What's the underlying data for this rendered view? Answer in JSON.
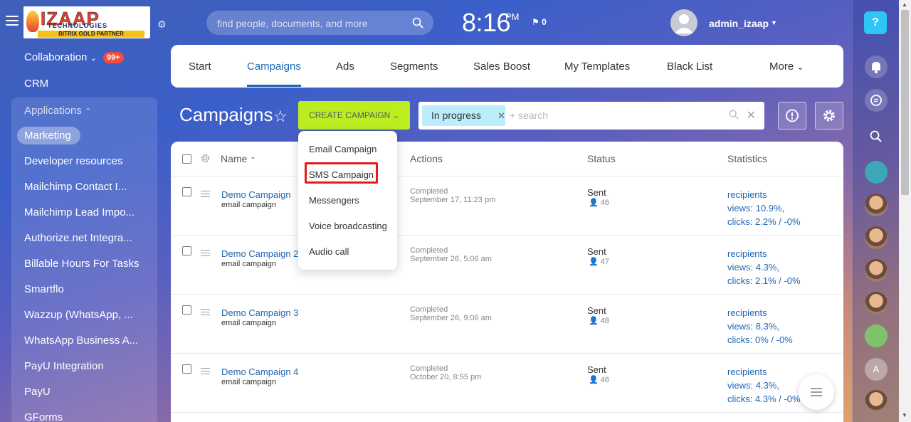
{
  "header": {
    "logo_main": "IZAAP",
    "logo_sub": "TECHNOLOGIES",
    "logo_partner": "BITRIX GOLD PARTNER",
    "search_placeholder": "find people, documents, and more",
    "clock_time": "8:16",
    "clock_ampm": "PM",
    "flag_count": "0",
    "username": "admin_izaap"
  },
  "sidebar": {
    "collaboration": "Collaboration",
    "collaboration_badge": "99+",
    "crm": "CRM",
    "applications": "Applications",
    "items": [
      "Marketing",
      "Developer resources",
      "Mailchimp Contact I...",
      "Mailchimp Lead Impo...",
      "Authorize.net Integra...",
      "Billable Hours For Tasks",
      "Smartflo",
      "Wazzup (WhatsApp, ...",
      "WhatsApp Business A...",
      "PayU Integration",
      "PayU",
      "GForms"
    ]
  },
  "tabs": [
    "Start",
    "Campaigns",
    "Ads",
    "Segments",
    "Sales Boost",
    "My Templates",
    "Black List",
    "More"
  ],
  "page": {
    "title": "Campaigns",
    "create_button": "CREATE CAMPAIGN",
    "filter_chip": "In progress",
    "filter_search_placeholder": "+ search"
  },
  "dropdown": {
    "items": [
      "Email Campaign",
      "SMS Campaign",
      "Messengers",
      "Voice broadcasting",
      "Audio call"
    ]
  },
  "grid": {
    "columns": [
      "Name",
      "Actions",
      "Status",
      "Statistics"
    ],
    "rows": [
      {
        "name": "Demo Campaign",
        "type": "email campaign",
        "action_state": "Completed",
        "action_date": "September 17, 11:23 pm",
        "status": "Sent",
        "count": "46",
        "s1": "recipients",
        "s2": "views: 10.9%,",
        "s3": "clicks: 2.2% / -0%"
      },
      {
        "name": "Demo Campaign 2",
        "type": "email campaign",
        "action_state": "Completed",
        "action_date": "September 26, 5:06 am",
        "status": "Sent",
        "count": "47",
        "s1": "recipients",
        "s2": "views: 4.3%,",
        "s3": "clicks: 2.1% / -0%"
      },
      {
        "name": "Demo Campaign 3",
        "type": "email campaign",
        "action_state": "Completed",
        "action_date": "September 26, 9:06 am",
        "status": "Sent",
        "count": "48",
        "s1": "recipients",
        "s2": "views: 8.3%,",
        "s3": "clicks: 0% / -0%"
      },
      {
        "name": "Demo Campaign 4",
        "type": "email campaign",
        "action_state": "Completed",
        "action_date": "October 20, 8:55 pm",
        "status": "Sent",
        "count": "46",
        "s1": "recipients",
        "s2": "views: 4.3%,",
        "s3": "clicks: 4.3% / -0%"
      }
    ]
  },
  "rightbar": {
    "help_label": "?",
    "letter_avatar": "A"
  },
  "colors": {
    "accent": "#1f66b5",
    "create_button": "#bbed21",
    "badge": "#f14e3f",
    "help": "#2fc6f6",
    "highlight": "#e51b1b"
  }
}
